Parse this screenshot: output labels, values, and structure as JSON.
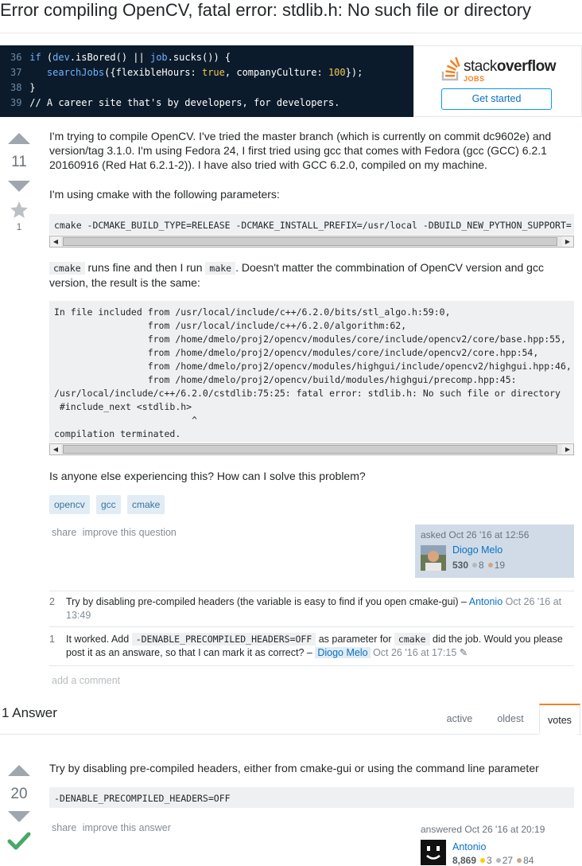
{
  "question": {
    "title": "Error compiling OpenCV, fatal error: stdlib.h: No such file or directory",
    "score": "11",
    "favorites": "1",
    "body": {
      "p1": "I'm trying to compile OpenCV. I've tried the master branch (which is currently on commit dc9602e) and version/tag 3.1.0. I'm using Fedora 24, I first tried using gcc that comes with Fedora (gcc (GCC) 6.2.1 20160916 (Red Hat 6.2.1-2)). I have also tried with GCC 6.2.0, compiled on my machine.",
      "p2": "I'm using cmake with the following parameters:",
      "cmake_cmd": "cmake -DCMAKE_BUILD_TYPE=RELEASE -DCMAKE_INSTALL_PREFIX=/usr/local -DBUILD_NEW_PYTHON_SUPPORT=",
      "p3_code1": "cmake",
      "p3_a": " runs fine and then I run ",
      "p3_code2": "make",
      "p3_b": ". Doesn't matter the commbination of OpenCV version and gcc version, the result is the same:",
      "error_lines": [
        "In file included from /usr/local/include/c++/6.2.0/bits/stl_algo.h:59:0,",
        "                 from /usr/local/include/c++/6.2.0/algorithm:62,",
        "                 from /home/dmelo/proj2/opencv/modules/core/include/opencv2/core/base.hpp:55,",
        "                 from /home/dmelo/proj2/opencv/modules/core/include/opencv2/core.hpp:54,",
        "                 from /home/dmelo/proj2/opencv/modules/highgui/include/opencv2/highgui.hpp:46,",
        "                 from /home/dmelo/proj2/opencv/build/modules/highgui/precomp.hpp:45:",
        "/usr/local/include/c++/6.2.0/cstdlib:75:25: fatal error: stdlib.h: No such file or directory",
        " #include_next <stdlib.h>",
        "                         ^",
        "compilation terminated."
      ],
      "p4": "Is anyone else experiencing this? How can I solve this problem?"
    },
    "tags": [
      "opencv",
      "gcc",
      "cmake"
    ],
    "menu": {
      "share": "share",
      "improve": "improve this question"
    },
    "asked": {
      "when": "asked Oct 26 '16 at 12:56",
      "user": "Diogo Melo",
      "reputation": "530",
      "silver": "8",
      "bronze": "19"
    },
    "comments": [
      {
        "score": "2",
        "text": "Try by disabling pre-compiled headers (the variable is easy to find if you open cmake-gui) – ",
        "user": "Antonio",
        "date": "Oct 26 '16 at 13:49"
      },
      {
        "score": "1",
        "text_a": "It worked. Add ",
        "code_a": "-DENABLE_PRECOMPILED_HEADERS=OFF",
        "text_b": " as parameter for ",
        "code_b": "cmake",
        "text_c": " did the job. Would you please post it as an answare, so that I can mark it as correct? – ",
        "user": "Diogo Melo",
        "date": "Oct 26 '16 at 17:15"
      }
    ],
    "add_comment": "add a comment"
  },
  "answers_header": {
    "count_label": "1 Answer",
    "tabs": [
      "active",
      "oldest",
      "votes"
    ],
    "active_tab": "votes"
  },
  "answer": {
    "score": "20",
    "text": "Try by disabling pre-compiled headers, either from cmake-gui or using the command line parameter",
    "code": "-DENABLE_PRECOMPILED_HEADERS=OFF",
    "menu": {
      "share": "share",
      "improve": "improve this answer"
    },
    "answered": {
      "when": "answered Oct 26 '16 at 20:19",
      "user": "Antonio",
      "reputation": "8,869",
      "gold": "3",
      "silver": "27",
      "bronze": "84"
    }
  },
  "ad": {
    "code_lines": [
      {
        "n": "36",
        "text": "if (dev.isBored() || job.sucks()) {"
      },
      {
        "n": "37",
        "text": "   searchJobs({flexibleHours: true, companyCulture: 100});"
      },
      {
        "n": "38",
        "text": "}"
      },
      {
        "n": "39",
        "text": "// A career site that's by developers, for developers."
      }
    ],
    "brand_a": "stack",
    "brand_b": "overflow",
    "jobs": "JOBS",
    "cta": "Get started"
  },
  "colors": {
    "accent": "#f48024",
    "link": "#0a70c2",
    "tag_bg": "#e1ecf4",
    "accepted": "#48a868"
  }
}
